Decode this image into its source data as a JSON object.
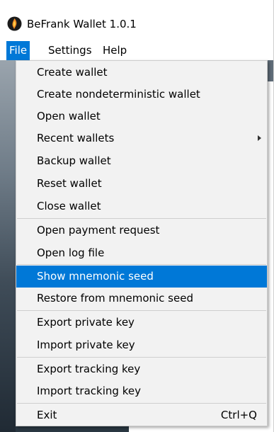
{
  "window": {
    "title": "BeFrank Wallet 1.0.1",
    "icon": "befrank-logo-icon"
  },
  "menubar": {
    "items": [
      {
        "label": "File",
        "active": true
      },
      {
        "label": "Settings",
        "active": false
      },
      {
        "label": "Help",
        "active": false
      }
    ]
  },
  "file_menu": {
    "items": [
      {
        "label": "Create wallet"
      },
      {
        "label": "Create nondeterministic wallet"
      },
      {
        "label": "Open wallet"
      },
      {
        "label": "Recent wallets",
        "submenu": true
      },
      {
        "label": "Backup wallet"
      },
      {
        "label": "Reset wallet"
      },
      {
        "label": "Close wallet"
      },
      {
        "label": "Open payment request"
      },
      {
        "label": "Open log file"
      },
      {
        "label": "Show mnemonic seed",
        "highlighted": true
      },
      {
        "label": "Restore from mnemonic seed"
      },
      {
        "label": "Export private key"
      },
      {
        "label": "Import private key"
      },
      {
        "label": "Export tracking key"
      },
      {
        "label": "Import tracking key"
      },
      {
        "label": "Exit",
        "shortcut": "Ctrl+Q"
      }
    ]
  },
  "colors": {
    "highlight": "#0078d7",
    "menu_background": "#f2f2f2"
  }
}
